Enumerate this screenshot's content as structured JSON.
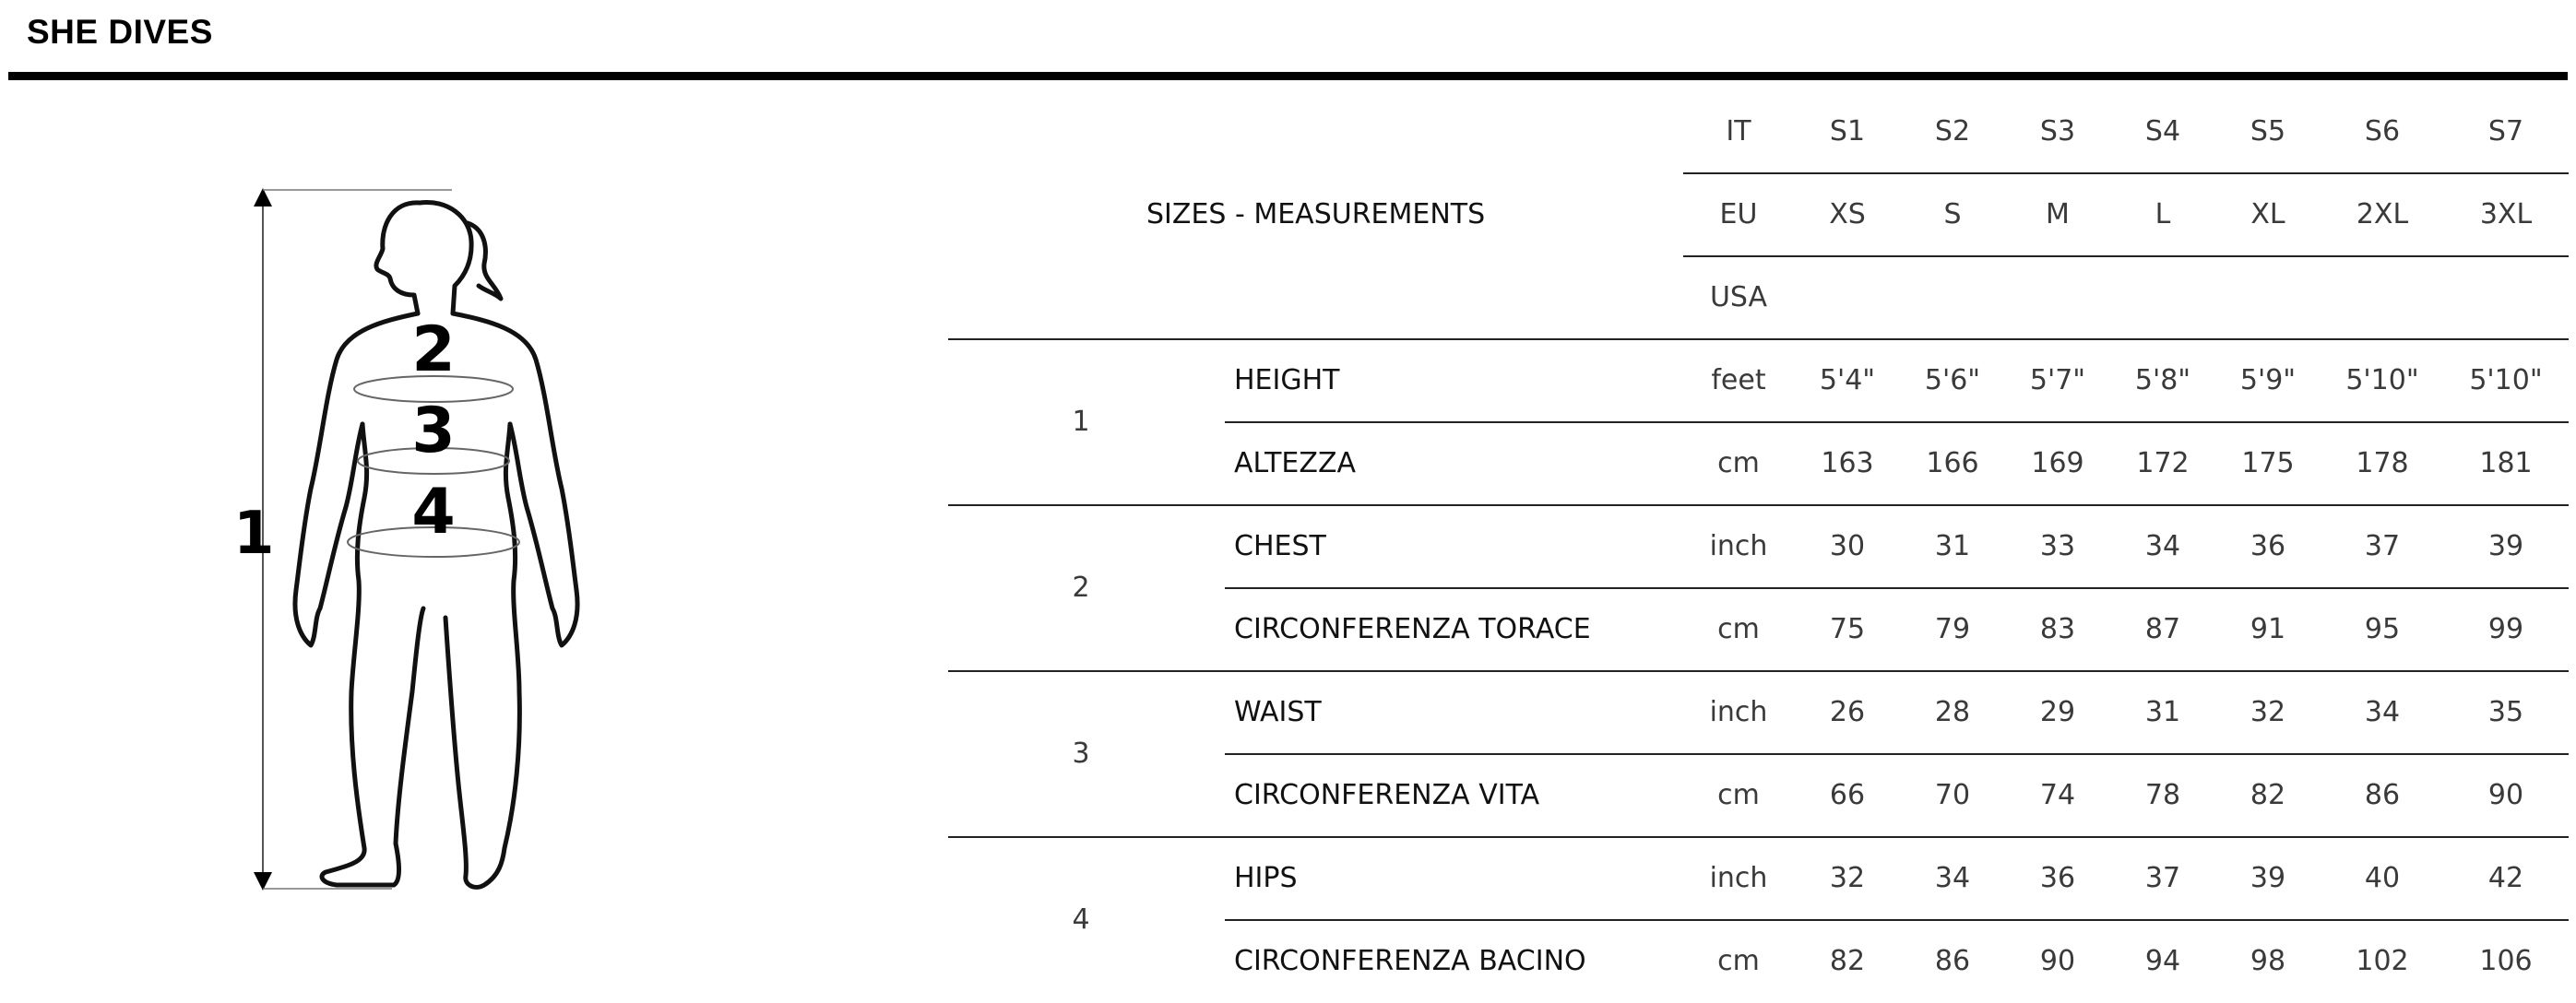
{
  "brand": "SHE DIVES",
  "figure": {
    "labels": {
      "height": "1",
      "chest": "2",
      "waist": "3",
      "hips": "4"
    }
  },
  "table": {
    "title": "SIZES - MEASUREMENTS",
    "header_rows": [
      {
        "system": "IT",
        "sizes": [
          "S1",
          "S2",
          "S3",
          "S4",
          "S5",
          "S6",
          "S7"
        ]
      },
      {
        "system": "EU",
        "sizes": [
          "XS",
          "S",
          "M",
          "L",
          "XL",
          "2XL",
          "3XL"
        ]
      },
      {
        "system": "USA",
        "sizes": [
          "",
          "",
          "",
          "",
          "",
          "",
          ""
        ]
      }
    ],
    "groups": [
      {
        "number": "1",
        "rows": [
          {
            "label": "HEIGHT",
            "unit": "feet",
            "values": [
              "5'4\"",
              "5'6\"",
              "5'7\"",
              "5'8\"",
              "5'9\"",
              "5'10\"",
              "5'10\""
            ]
          },
          {
            "label": "ALTEZZA",
            "unit": "cm",
            "values": [
              "163",
              "166",
              "169",
              "172",
              "175",
              "178",
              "181"
            ]
          }
        ]
      },
      {
        "number": "2",
        "rows": [
          {
            "label": "CHEST",
            "unit": "inch",
            "values": [
              "30",
              "31",
              "33",
              "34",
              "36",
              "37",
              "39"
            ]
          },
          {
            "label": "CIRCONFERENZA TORACE",
            "unit": "cm",
            "values": [
              "75",
              "79",
              "83",
              "87",
              "91",
              "95",
              "99"
            ]
          }
        ]
      },
      {
        "number": "3",
        "rows": [
          {
            "label": "WAIST",
            "unit": "inch",
            "values": [
              "26",
              "28",
              "29",
              "31",
              "32",
              "34",
              "35"
            ]
          },
          {
            "label": "CIRCONFERENZA VITA",
            "unit": "cm",
            "values": [
              "66",
              "70",
              "74",
              "78",
              "82",
              "86",
              "90"
            ]
          }
        ]
      },
      {
        "number": "4",
        "rows": [
          {
            "label": "HIPS",
            "unit": "inch",
            "values": [
              "32",
              "34",
              "36",
              "37",
              "39",
              "40",
              "42"
            ]
          },
          {
            "label": "CIRCONFERENZA BACINO",
            "unit": "cm",
            "values": [
              "82",
              "86",
              "90",
              "94",
              "98",
              "102",
              "106"
            ]
          }
        ]
      }
    ]
  }
}
